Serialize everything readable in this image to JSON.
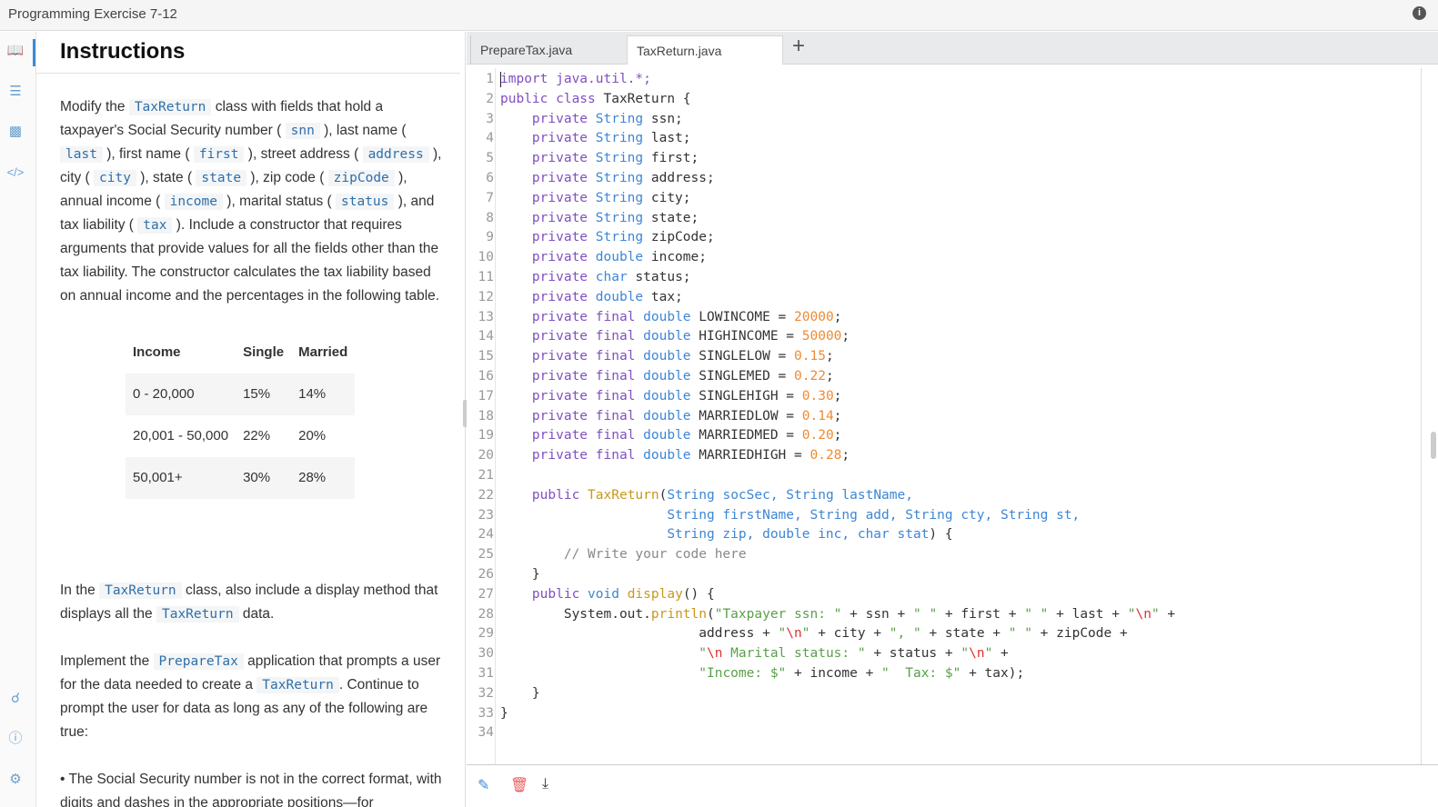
{
  "window": {
    "title": "Programming Exercise 7-12",
    "info_icon": "i"
  },
  "instructions": {
    "heading": "Instructions",
    "p1": [
      "Modify the ",
      "TaxReturn",
      " class with fields that hold a taxpayer's Social Security number ( ",
      "snn",
      " ), last name ( ",
      "last",
      " ), first name ( ",
      "first",
      " ), street address ( ",
      "address",
      " ), city ( ",
      "city",
      " ), state ( ",
      "state",
      " ), zip code ( ",
      "zipCode",
      " ), annual income ( ",
      "income",
      " ), marital status ( ",
      "status",
      " ), and tax liability ( ",
      "tax",
      " ). Include a constructor that requires arguments that provide values for all the fields other than the tax liability. The constructor calculates the tax liability based on annual income and the percentages in the following table."
    ],
    "table": {
      "headers": [
        "Income",
        "Single",
        "Married"
      ],
      "rows": [
        [
          "0 - 20,000",
          "15%",
          "14%"
        ],
        [
          "20,001 - 50,000",
          "22%",
          "20%"
        ],
        [
          "50,001+",
          "30%",
          "28%"
        ]
      ]
    },
    "p2": [
      "In the ",
      "TaxReturn",
      " class, also include a display method that displays all the ",
      "TaxReturn",
      " data."
    ],
    "p3": [
      "Implement the ",
      "PrepareTax",
      " application that prompts a user for the data needed to create a ",
      "TaxReturn",
      ". Continue to prompt the user for data as long as any of the following are true:"
    ],
    "p4": "• The Social Security number is not in the correct format, with digits and dashes in the appropriate positions—for"
  },
  "editor": {
    "tabs": [
      "PrepareTax.java",
      "TaxReturn.java"
    ],
    "add_tab": "+",
    "lines": [
      [
        [
          "k",
          "import java.util.*;"
        ]
      ],
      [
        [
          "k",
          "public class"
        ],
        [
          "p",
          " TaxReturn {"
        ]
      ],
      [
        [
          "p",
          "    "
        ],
        [
          "k",
          "private"
        ],
        [
          "t",
          " String"
        ],
        [
          "p",
          " ssn;"
        ]
      ],
      [
        [
          "p",
          "    "
        ],
        [
          "k",
          "private"
        ],
        [
          "t",
          " String"
        ],
        [
          "p",
          " last;"
        ]
      ],
      [
        [
          "p",
          "    "
        ],
        [
          "k",
          "private"
        ],
        [
          "t",
          " String"
        ],
        [
          "p",
          " first;"
        ]
      ],
      [
        [
          "p",
          "    "
        ],
        [
          "k",
          "private"
        ],
        [
          "t",
          " String"
        ],
        [
          "p",
          " address;"
        ]
      ],
      [
        [
          "p",
          "    "
        ],
        [
          "k",
          "private"
        ],
        [
          "t",
          " String"
        ],
        [
          "p",
          " city;"
        ]
      ],
      [
        [
          "p",
          "    "
        ],
        [
          "k",
          "private"
        ],
        [
          "t",
          " String"
        ],
        [
          "p",
          " state;"
        ]
      ],
      [
        [
          "p",
          "    "
        ],
        [
          "k",
          "private"
        ],
        [
          "t",
          " String"
        ],
        [
          "p",
          " zipCode;"
        ]
      ],
      [
        [
          "p",
          "    "
        ],
        [
          "k",
          "private"
        ],
        [
          "t",
          " double"
        ],
        [
          "p",
          " income;"
        ]
      ],
      [
        [
          "p",
          "    "
        ],
        [
          "k",
          "private"
        ],
        [
          "t",
          " char"
        ],
        [
          "p",
          " status;"
        ]
      ],
      [
        [
          "p",
          "    "
        ],
        [
          "k",
          "private"
        ],
        [
          "t",
          " double"
        ],
        [
          "p",
          " tax;"
        ]
      ],
      [
        [
          "p",
          "    "
        ],
        [
          "k",
          "private final"
        ],
        [
          "t",
          " double"
        ],
        [
          "p",
          " LOWINCOME = "
        ],
        [
          "n",
          "20000"
        ],
        [
          "p",
          ";"
        ]
      ],
      [
        [
          "p",
          "    "
        ],
        [
          "k",
          "private final"
        ],
        [
          "t",
          " double"
        ],
        [
          "p",
          " HIGHINCOME = "
        ],
        [
          "n",
          "50000"
        ],
        [
          "p",
          ";"
        ]
      ],
      [
        [
          "p",
          "    "
        ],
        [
          "k",
          "private final"
        ],
        [
          "t",
          " double"
        ],
        [
          "p",
          " SINGLELOW = "
        ],
        [
          "n",
          "0.15"
        ],
        [
          "p",
          ";"
        ]
      ],
      [
        [
          "p",
          "    "
        ],
        [
          "k",
          "private final"
        ],
        [
          "t",
          " double"
        ],
        [
          "p",
          " SINGLEMED = "
        ],
        [
          "n",
          "0.22"
        ],
        [
          "p",
          ";"
        ]
      ],
      [
        [
          "p",
          "    "
        ],
        [
          "k",
          "private final"
        ],
        [
          "t",
          " double"
        ],
        [
          "p",
          " SINGLEHIGH = "
        ],
        [
          "n",
          "0.30"
        ],
        [
          "p",
          ";"
        ]
      ],
      [
        [
          "p",
          "    "
        ],
        [
          "k",
          "private final"
        ],
        [
          "t",
          " double"
        ],
        [
          "p",
          " MARRIEDLOW = "
        ],
        [
          "n",
          "0.14"
        ],
        [
          "p",
          ";"
        ]
      ],
      [
        [
          "p",
          "    "
        ],
        [
          "k",
          "private final"
        ],
        [
          "t",
          " double"
        ],
        [
          "p",
          " MARRIEDMED = "
        ],
        [
          "n",
          "0.20"
        ],
        [
          "p",
          ";"
        ]
      ],
      [
        [
          "p",
          "    "
        ],
        [
          "k",
          "private final"
        ],
        [
          "t",
          " double"
        ],
        [
          "p",
          " MARRIEDHIGH = "
        ],
        [
          "n",
          "0.28"
        ],
        [
          "p",
          ";"
        ]
      ],
      [],
      [
        [
          "p",
          "    "
        ],
        [
          "k",
          "public"
        ],
        [
          "f",
          " TaxReturn"
        ],
        [
          "p",
          "("
        ],
        [
          "t",
          "String socSec, String lastName,"
        ]
      ],
      [
        [
          "p",
          "                     "
        ],
        [
          "t",
          "String firstName, String add, String cty, String st,"
        ]
      ],
      [
        [
          "p",
          "                     "
        ],
        [
          "t",
          "String zip, double inc, char stat"
        ],
        [
          "p",
          ") {"
        ]
      ],
      [
        [
          "c",
          "        // Write your code here"
        ]
      ],
      [
        [
          "p",
          "    }"
        ]
      ],
      [
        [
          "p",
          "    "
        ],
        [
          "k",
          "public"
        ],
        [
          "t",
          " void"
        ],
        [
          "f",
          " display"
        ],
        [
          "p",
          "() {"
        ]
      ],
      [
        [
          "p",
          "        System.out."
        ],
        [
          "f",
          "println"
        ],
        [
          "p",
          "("
        ],
        [
          "s",
          "\"Taxpayer ssn: \""
        ],
        [
          "p",
          " + ssn + "
        ],
        [
          "s",
          "\" \""
        ],
        [
          "p",
          " + first + "
        ],
        [
          "s",
          "\" \""
        ],
        [
          "p",
          " + last + "
        ],
        [
          "s",
          "\""
        ],
        [
          "e",
          "\\n"
        ],
        [
          "s",
          "\""
        ],
        [
          "p",
          " +"
        ]
      ],
      [
        [
          "p",
          "                         address + "
        ],
        [
          "s",
          "\""
        ],
        [
          "e",
          "\\n"
        ],
        [
          "s",
          "\""
        ],
        [
          "p",
          " + city + "
        ],
        [
          "s",
          "\", \""
        ],
        [
          "p",
          " + state + "
        ],
        [
          "s",
          "\" \""
        ],
        [
          "p",
          " + zipCode +"
        ]
      ],
      [
        [
          "p",
          "                         "
        ],
        [
          "s",
          "\""
        ],
        [
          "e",
          "\\n"
        ],
        [
          "s",
          " Marital status: \""
        ],
        [
          "p",
          " + status + "
        ],
        [
          "s",
          "\""
        ],
        [
          "e",
          "\\n"
        ],
        [
          "s",
          "\""
        ],
        [
          "p",
          " +"
        ]
      ],
      [
        [
          "p",
          "                         "
        ],
        [
          "s",
          "\"Income: $\""
        ],
        [
          "p",
          " + income + "
        ],
        [
          "s",
          "\"  Tax: $\""
        ],
        [
          "p",
          " + tax);"
        ]
      ],
      [
        [
          "p",
          "    }"
        ]
      ],
      [
        [
          "p",
          "}"
        ]
      ],
      []
    ]
  }
}
